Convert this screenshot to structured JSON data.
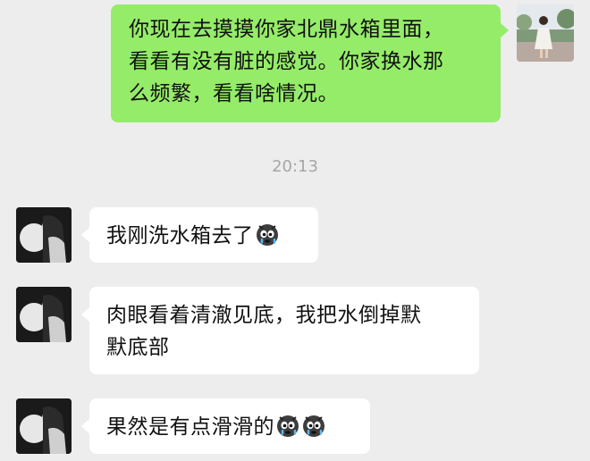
{
  "chat": {
    "outgoing": {
      "text_line1": "你现在去摸摸你家北鼎水箱里面，",
      "text_line2": "看看有没有脏的感觉。你家换水那",
      "text_line3": "么频繁，看看啥情况。"
    },
    "timestamp": "20:13",
    "incoming": [
      {
        "text": "我刚洗水箱去了",
        "emoji_count": 1,
        "emoji_icon": "crying-emoji-icon"
      },
      {
        "text_line1": "肉眼看着清澈见底，我把水倒掉默",
        "text_line2": "默底部"
      },
      {
        "text": "果然是有点滑滑的",
        "emoji_count": 2,
        "emoji_icon": "crying-emoji-icon"
      }
    ]
  },
  "colors": {
    "background": "#ededed",
    "outgoing_bubble": "#95ec69",
    "incoming_bubble": "#ffffff",
    "timestamp_text": "#a6a6a6"
  }
}
